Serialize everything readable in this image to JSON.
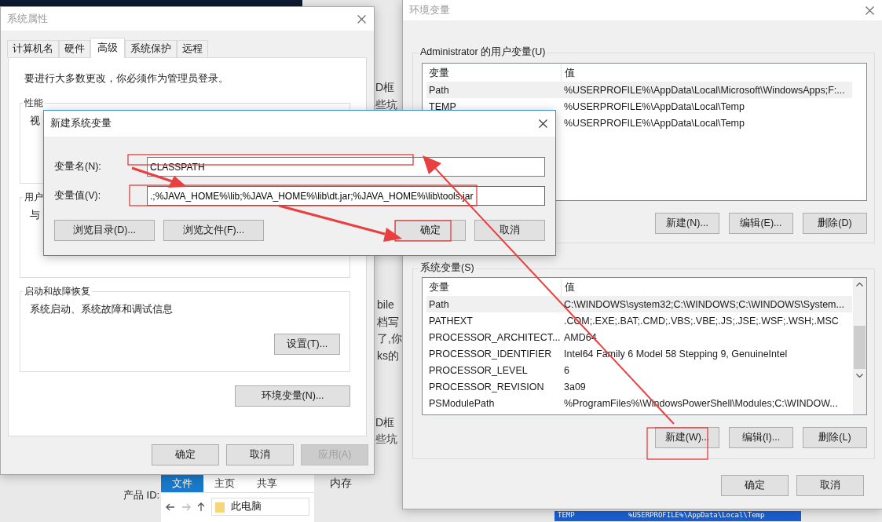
{
  "background_page": {
    "lines": [
      "D框",
      "些坑",
      "bile",
      "档写",
      "了,你",
      "ks的",
      "D框",
      "些坑",
      "内存"
    ]
  },
  "explorer": {
    "label": "产品 ID:",
    "ribbon_tabs": [
      {
        "label": "文件",
        "selected": true
      },
      {
        "label": "主页",
        "selected": false
      },
      {
        "label": "共享",
        "selected": false
      }
    ],
    "address": "此电脑"
  },
  "system_properties": {
    "title": "系统属性",
    "tabs": [
      {
        "label": "计算机名",
        "selected": false
      },
      {
        "label": "硬件",
        "selected": false
      },
      {
        "label": "高级",
        "selected": true
      },
      {
        "label": "系统保护",
        "selected": false
      },
      {
        "label": "远程",
        "selected": false
      }
    ],
    "notice": "要进行大多数更改，你必须作为管理员登录。",
    "groups": [
      {
        "title": "性能",
        "text": "视"
      },
      {
        "title": "用户",
        "text": "与"
      },
      {
        "title": "启动和故障恢复",
        "text": "系统启动、系统故障和调试信息",
        "button": "设置(T)..."
      }
    ],
    "env_button": "环境变量(N)...",
    "buttons": [
      {
        "label": "确定",
        "disabled": false
      },
      {
        "label": "取消",
        "disabled": false
      },
      {
        "label": "应用(A)",
        "disabled": true
      }
    ]
  },
  "new_variable_dialog": {
    "title": "新建系统变量",
    "fields": [
      {
        "label": "变量名(N):",
        "value": "CLASSPATH",
        "focused": false
      },
      {
        "label": "变量值(V):",
        "value": ".;%JAVA_HOME%\\lib;%JAVA_HOME%\\lib\\dt.jar;%JAVA_HOME%\\lib\\tools.jar",
        "focused": true
      }
    ],
    "browse_buttons": [
      "浏览目录(D)...",
      "浏览文件(F)..."
    ],
    "buttons": [
      "确定",
      "取消"
    ]
  },
  "environment_variables": {
    "title": "环境变量",
    "sections": [
      {
        "title": "Administrator 的用户变量(U)",
        "columns": [
          "变量",
          "值"
        ],
        "rows": [
          {
            "name": "Path",
            "value": "%USERPROFILE%\\AppData\\Local\\Microsoft\\WindowsApps;F:...",
            "selected": true
          },
          {
            "name": "TEMP",
            "value": "%USERPROFILE%\\AppData\\Local\\Temp",
            "selected": false
          },
          {
            "value": "%USERPROFILE%\\AppData\\Local\\Temp",
            "selected": false
          }
        ],
        "scrollbar": false,
        "buttons": [
          "新建(N)...",
          "编辑(E)...",
          "删除(D)"
        ]
      },
      {
        "title": "系统变量(S)",
        "columns": [
          "变量",
          "值"
        ],
        "rows": [
          {
            "name": "Path",
            "value": "C:\\WINDOWS\\system32;C:\\WINDOWS;C:\\WINDOWS\\System...",
            "selected": true
          },
          {
            "name": "PATHEXT",
            "value": ".COM;.EXE;.BAT;.CMD;.VBS;.VBE;.JS;.JSE;.WSF;.WSH;.MSC",
            "selected": false
          },
          {
            "name": "PROCESSOR_ARCHITECT...",
            "value": "AMD64",
            "selected": false
          },
          {
            "name": "PROCESSOR_IDENTIFIER",
            "value": "Intel64 Family 6 Model 58 Stepping 9, GenuineIntel",
            "selected": false
          },
          {
            "name": "PROCESSOR_LEVEL",
            "value": "6",
            "selected": false
          },
          {
            "name": "PROCESSOR_REVISION",
            "value": "3a09",
            "selected": false
          },
          {
            "name": "PSModulePath",
            "value": "%ProgramFiles%\\WindowsPowerShell\\Modules;C:\\WINDOW...",
            "selected": false
          }
        ],
        "scrollbar": true,
        "buttons": [
          "新建(W)...",
          "编辑(I)...",
          "删除(L)"
        ]
      }
    ],
    "buttons": [
      "确定",
      "取消"
    ]
  },
  "bottom_row": {
    "name": "TEMP",
    "value": "%USERPROFILE%\\AppData\\Local\\Temp"
  }
}
